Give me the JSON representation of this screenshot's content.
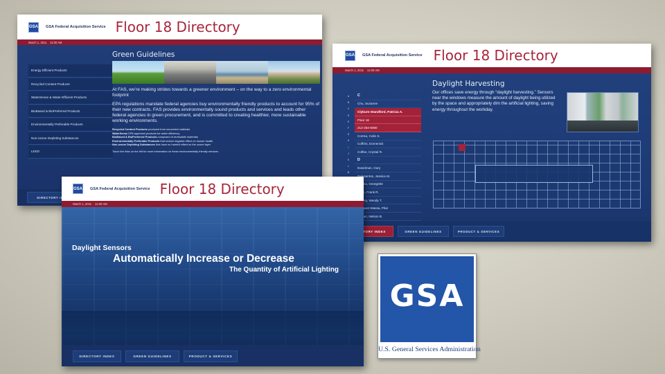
{
  "screens": {
    "green": {
      "logo": "GSA",
      "org": "GSA Federal Acquisition Service",
      "title": "Floor 18 Directory",
      "datetime": "March 1, 2011    11:00 AM",
      "heading": "Green Guidelines",
      "menu": [
        "Energy Efficient Products",
        "Recycled Content Products",
        "WaterSense & Water-Efficient Products",
        "BioBased & BioPreferred Products",
        "Environmentally Preferable Products",
        "Non-ozone Depleting Substances",
        "LEED"
      ],
      "intro": "At FAS, we’re making strides towards a greener environment – on the way to a zero environmental footprint",
      "body": "EPA regulations mandate federal agencies buy environmentally friendly products to account for 95% of their new contracts. FAS provides environmentally sound products and services and leads other federal agencies in green procurement, and is committed to creating healthier, more sustainable working environments.",
      "definitions": [
        {
          "term": "Recycled Content Products",
          "text": "produced from recovered materials"
        },
        {
          "term": "WaterSense",
          "text": "EPA approved products for water efficiency"
        },
        {
          "term": "BioBased & BioPreferred Products",
          "text": "composed of renewable materials"
        },
        {
          "term": "Environmentally Preferable Products",
          "text": "that reduce negative effect on human health"
        },
        {
          "term": "Non-ozone Depleting Substances",
          "text": "that have no harmful effect on the ozone layer"
        }
      ],
      "touch_note": "Touch the links on the left for more information on these environmentally friendly services",
      "nav": [
        "DIRECTORY INDEX"
      ]
    },
    "daylight": {
      "logo": "GSA",
      "org": "GSA Federal Acquisition Service",
      "title": "Floor 18 Directory",
      "datetime": "March 1, 2011    11:00 AM",
      "heading": "Daylight Harvesting",
      "body": "Our offices save energy through “daylight harvesting.” Sensors near the windows measure the amount of daylight being utilized by the space and appropriately dim the artificial lighting, saving energy throughout the workday.",
      "alphabet": [
        "A",
        "B",
        "C",
        "D",
        "E",
        "F",
        "G",
        "H",
        "I",
        "J",
        "K",
        "L",
        "M",
        "N",
        "O",
        "P",
        "Q",
        "R",
        "S",
        "T",
        "U",
        "V",
        "W",
        "X",
        "Y",
        "Z"
      ],
      "alphabet_highlight": "C",
      "directory": [
        {
          "text": "C",
          "type": "letter"
        },
        {
          "text": "Chu, Suzanne",
          "type": "name"
        },
        {
          "text": "Clyburn-Standford, Patricia A.",
          "type": "selected"
        },
        {
          "text": "Floor 18",
          "type": "selected-sub"
        },
        {
          "text": "212-264-6000",
          "type": "selected-sub"
        },
        {
          "text": "Correa, Colin S.",
          "type": "name"
        },
        {
          "text": "Coffrini, Domenick",
          "type": "name"
        },
        {
          "text": "Coffee, Crystal R.",
          "type": "name"
        },
        {
          "text": "D",
          "type": "letter"
        },
        {
          "text": "Davidman, Gary",
          "type": "name"
        },
        {
          "text": "Delosantos, Jessica M.",
          "type": "name"
        },
        {
          "text": "...atina, Georgette",
          "type": "name"
        },
        {
          "text": "...Dio, Frank R.",
          "type": "name"
        },
        {
          "text": "...berry, Wendy T.",
          "type": "name"
        },
        {
          "text": "...inguez-Massa, Pilar",
          "type": "name"
        },
        {
          "text": "...ncan, Nelson B.",
          "type": "name"
        }
      ],
      "nav": [
        "...CTORY INDEX",
        "GREEN GUIDELINES",
        "PRODUCT & SERVICES"
      ]
    },
    "sensors": {
      "logo": "GSA",
      "org": "GSA Federal Acquisition Service",
      "title": "Floor 18 Directory",
      "datetime": "March 1, 2011    11:00 AM",
      "line1": "Daylight Sensors",
      "line2": "Automatically Increase or Decrease",
      "line3": "The Quantity of Artificial Lighting",
      "nav": [
        "DIRECTORY INDEX",
        "GREEN GUIDELINES",
        "PRODUCT & SERVICES"
      ]
    }
  },
  "gsa_logo": {
    "letters": "GSA",
    "caption": "U.S. General Services Administration",
    "color": "#2355a8"
  },
  "colors": {
    "brand_red": "#8e1b30",
    "panel_blue": "#1f3f78",
    "title_red": "#a8253a"
  }
}
